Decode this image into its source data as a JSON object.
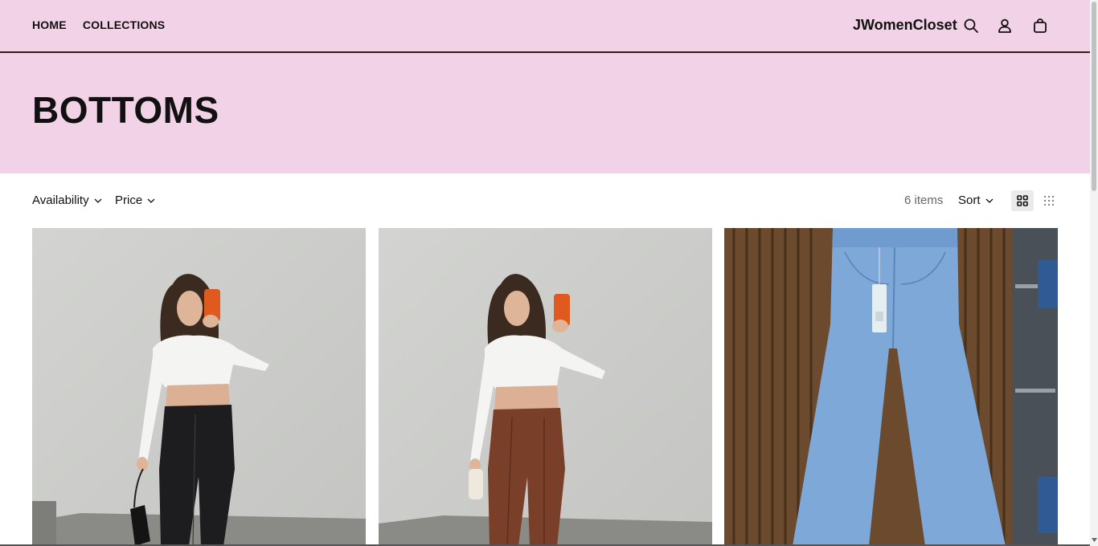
{
  "header": {
    "nav": [
      {
        "label": "HOME"
      },
      {
        "label": "COLLECTIONS"
      }
    ],
    "brand": "JWomenCloset",
    "icons": [
      "search-icon",
      "account-icon",
      "cart-icon"
    ],
    "background": "#f2d2e7"
  },
  "hero": {
    "title": "BOTTOMS"
  },
  "toolbar": {
    "filters": [
      {
        "label": "Availability"
      },
      {
        "label": "Price"
      }
    ],
    "count": "6 items",
    "sort_label": "Sort",
    "views": [
      "grid-large-icon",
      "grid-small-icon"
    ]
  },
  "products": [
    {
      "image": "black-leather-pants-photo"
    },
    {
      "image": "brown-leather-pants-photo"
    },
    {
      "image": "blue-jeans-photo"
    }
  ]
}
